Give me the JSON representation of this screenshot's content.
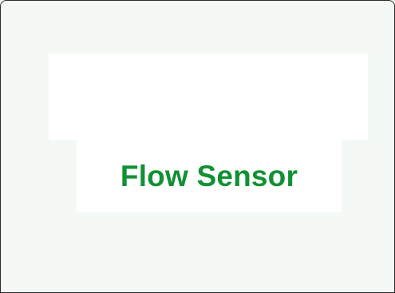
{
  "card": {
    "title": "Flow Sensor"
  },
  "colors": {
    "background": "#f4f9f5",
    "panel": "#ffffff",
    "title_text": "#119133",
    "border": "#2b2b2b"
  }
}
